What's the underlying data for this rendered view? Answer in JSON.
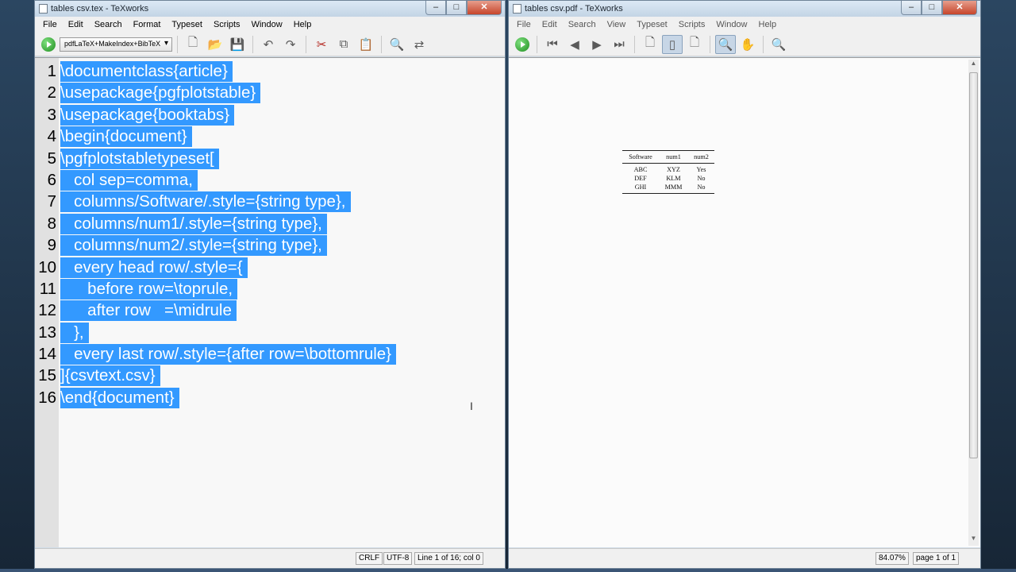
{
  "left_window": {
    "title": "tables csv.tex - TeXworks",
    "menu": [
      "File",
      "Edit",
      "Search",
      "Format",
      "Typeset",
      "Scripts",
      "Window",
      "Help"
    ],
    "typeset_engine": "pdfLaTeX+MakeIndex+BibTeX",
    "code_lines": [
      {
        "n": "1",
        "text": "\\documentclass{article}"
      },
      {
        "n": "2",
        "text": "\\usepackage{pgfplotstable}"
      },
      {
        "n": "3",
        "text": "\\usepackage{booktabs}"
      },
      {
        "n": "4",
        "text": "\\begin{document}"
      },
      {
        "n": "5",
        "text": "\\pgfplotstabletypeset["
      },
      {
        "n": "6",
        "text": "   col sep=comma,"
      },
      {
        "n": "7",
        "text": "   columns/Software/.style={string type},"
      },
      {
        "n": "8",
        "text": "   columns/num1/.style={string type},"
      },
      {
        "n": "9",
        "text": "   columns/num2/.style={string type},"
      },
      {
        "n": "10",
        "text": "   every head row/.style={"
      },
      {
        "n": "11",
        "text": "      before row=\\toprule,"
      },
      {
        "n": "12",
        "text": "      after row   =\\midrule"
      },
      {
        "n": "13",
        "text": "   },"
      },
      {
        "n": "14",
        "text": "   every last row/.style={after row=\\bottomrule}"
      },
      {
        "n": "15",
        "text": "]{csvtext.csv}"
      },
      {
        "n": "16",
        "text": "\\end{document}"
      }
    ],
    "status": {
      "line_ending": "CRLF",
      "encoding": "UTF-8",
      "position": "Line 1 of 16; col 0"
    }
  },
  "right_window": {
    "title": "tables csv.pdf - TeXworks",
    "menu": [
      "File",
      "Edit",
      "Search",
      "View",
      "Typeset",
      "Scripts",
      "Window",
      "Help"
    ],
    "pdf_table": {
      "headers": [
        "Software",
        "num1",
        "num2"
      ],
      "rows": [
        [
          "ABC",
          "XYZ",
          "Yes"
        ],
        [
          "DEF",
          "KLM",
          "No"
        ],
        [
          "GHI",
          "MMM",
          "No"
        ]
      ]
    },
    "status": {
      "zoom": "84.07%",
      "page": "page 1 of 1"
    }
  },
  "window_buttons": {
    "minimize": "–",
    "maximize": "□",
    "close": "✕"
  }
}
